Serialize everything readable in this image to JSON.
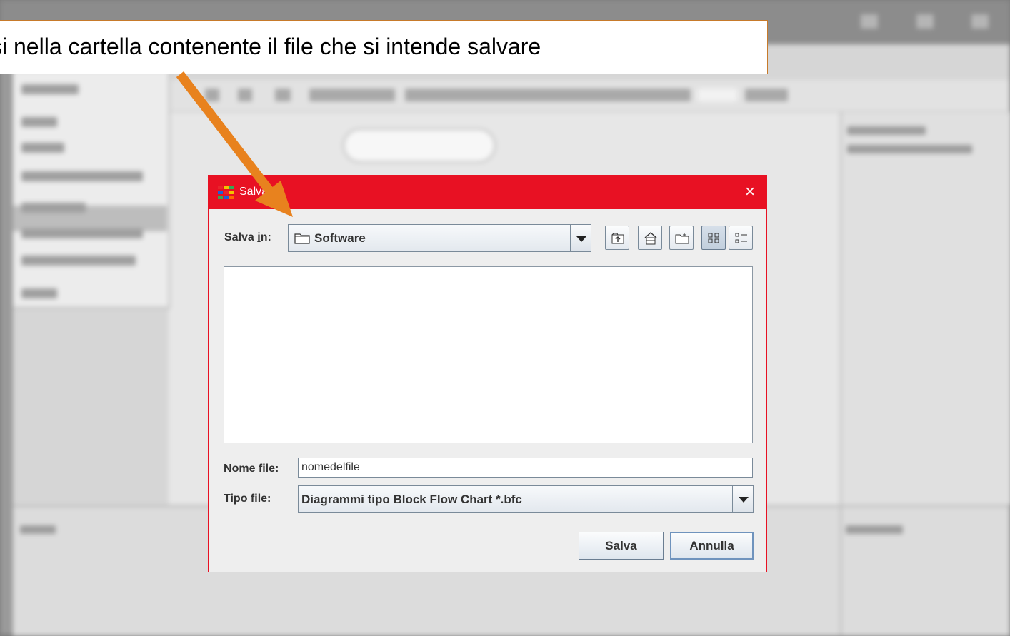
{
  "callout": {
    "text": "si nella cartella contenente il file che si intende salvare",
    "arrow_color": "#E8821E"
  },
  "dialog": {
    "title": "Salva",
    "title_bar_color": "#E81123",
    "close_symbol": "×",
    "look_in_label": "Salva in:",
    "look_in_value": "Software",
    "nav_buttons": [
      "up-one-level-icon",
      "home-icon",
      "new-folder-icon",
      "list-view-icon",
      "details-view-icon"
    ],
    "file_name_label": "Nome file:",
    "file_name_value": "nomedelfile",
    "file_type_label": "Tipo file:",
    "file_type_value": "Diagrammi tipo Block Flow Chart *.bfc",
    "save_button": "Salva",
    "cancel_button": "Annulla"
  }
}
